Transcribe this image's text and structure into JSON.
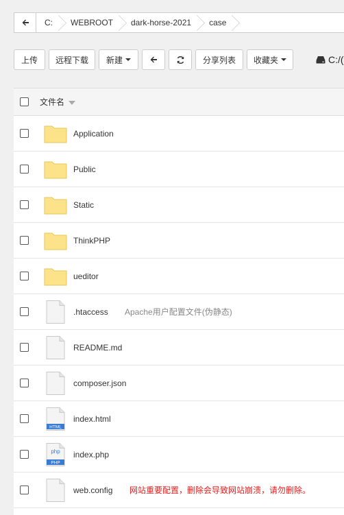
{
  "breadcrumb": {
    "back_icon": "arrow-left-icon",
    "items": [
      "C:",
      "WEBROOT",
      "dark-horse-2021",
      "case"
    ]
  },
  "toolbar": {
    "upload": "上传",
    "remote_download": "远程下载",
    "new": "新建",
    "share_list": "分享列表",
    "favorites": "收藏夹",
    "drive_label": "C:/(",
    "back_icon": "arrow-left-icon",
    "refresh_icon": "refresh-icon",
    "drive_icon": "hard-drive-icon"
  },
  "table": {
    "header": "文件名",
    "rows": [
      {
        "name": "Application",
        "type": "folder",
        "note": ""
      },
      {
        "name": "Public",
        "type": "folder",
        "note": ""
      },
      {
        "name": "Static",
        "type": "folder",
        "note": ""
      },
      {
        "name": "ThinkPHP",
        "type": "folder",
        "note": ""
      },
      {
        "name": "ueditor",
        "type": "folder",
        "note": ""
      },
      {
        "name": ".htaccess",
        "type": "file",
        "note": "Apache用户配置文件(伪静态)"
      },
      {
        "name": "README.md",
        "type": "file",
        "note": ""
      },
      {
        "name": "composer.json",
        "type": "file",
        "note": ""
      },
      {
        "name": "index.html",
        "type": "html",
        "note": "",
        "badge": "HTML",
        "glyph": "</>"
      },
      {
        "name": "index.php",
        "type": "php",
        "note": "",
        "badge": "PHP",
        "glyph": "php"
      },
      {
        "name": "web.config",
        "type": "file",
        "note": "网站重要配置，删除会导致网站崩溃，请勿删除。"
      }
    ]
  },
  "colors": {
    "folder": "#fce38a",
    "folder_border": "#e8c45a",
    "html_badge": "#3a7bd5",
    "php_badge": "#3a7bd5",
    "warning_note": "#e02020",
    "info_note": "#888888"
  }
}
